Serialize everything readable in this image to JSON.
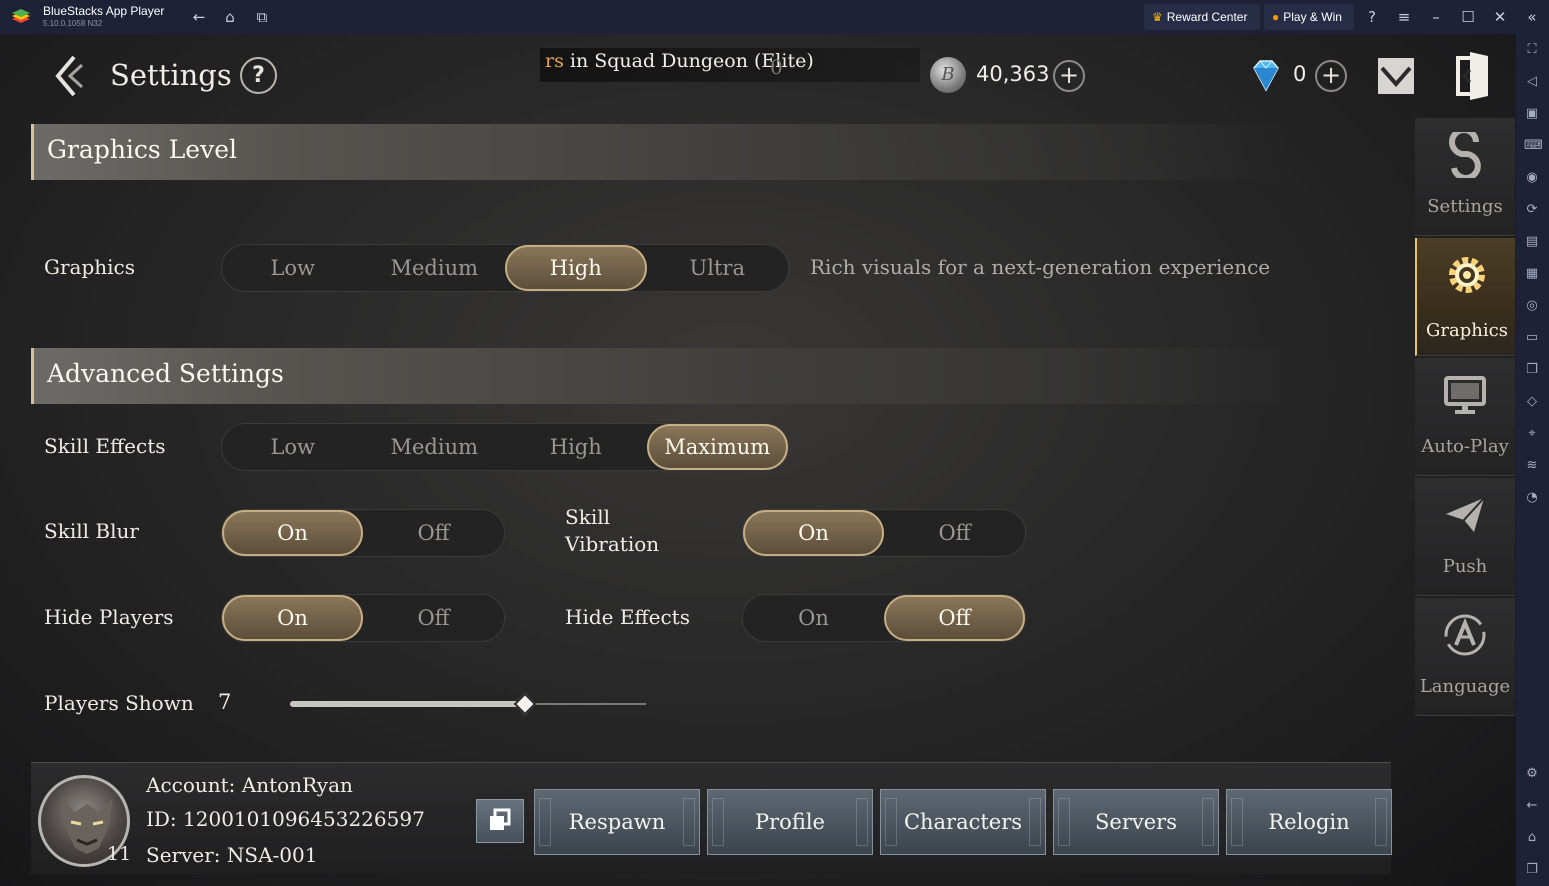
{
  "titlebar": {
    "app_name": "BlueStacks App Player",
    "version": "5.10.0.1058  N32",
    "reward_center": "Reward Center",
    "play_win": "Play & Win"
  },
  "header": {
    "title": "Settings",
    "help": "?",
    "ticker_prefix": "rs",
    "ticker_text": " in Squad Dungeon (Elite)",
    "ticker_count": "0",
    "silver_symbol": "B",
    "silver": "40,363",
    "gems": "0",
    "plus": "+"
  },
  "graphics_level": {
    "title": "Graphics Level",
    "graphics_label": "Graphics",
    "options": [
      "Low",
      "Medium",
      "High",
      "Ultra"
    ],
    "selected": "High",
    "description": "Rich visuals for a next-generation experience"
  },
  "advanced": {
    "title": "Advanced Settings",
    "skill_effects_label": "Skill Effects",
    "skill_effects_options": [
      "Low",
      "Medium",
      "High",
      "Maximum"
    ],
    "skill_effects_selected": "Maximum",
    "skill_blur_label": "Skill Blur",
    "skill_blur_selected": "On",
    "skill_vibration_label_1": "Skill",
    "skill_vibration_label_2": "Vibration",
    "skill_vibration_selected": "On",
    "hide_players_label": "Hide Players",
    "hide_players_selected": "On",
    "hide_effects_label": "Hide Effects",
    "hide_effects_selected": "Off",
    "on": "On",
    "off": "Off",
    "players_shown_label": "Players Shown",
    "players_shown_value": "7",
    "players_shown_fraction": 0.66
  },
  "side_tabs": [
    {
      "label": "Settings",
      "icon": "settings-s-icon"
    },
    {
      "label": "Graphics",
      "icon": "gear-icon"
    },
    {
      "label": "Auto-Play",
      "icon": "monitor-icon"
    },
    {
      "label": "Push",
      "icon": "paper-plane-icon"
    },
    {
      "label": "Language",
      "icon": "language-icon"
    }
  ],
  "active_tab": "Graphics",
  "account": {
    "name": "Account: AntonRyan",
    "id": "ID: 1200101096453226597",
    "server": "Server: NSA-001",
    "level": "11",
    "buttons": [
      "Respawn",
      "Profile",
      "Characters",
      "Servers",
      "Relogin"
    ]
  },
  "colors": {
    "accent_gold": "#c6ae82",
    "bluestacks_bar": "#1d2237",
    "ticker_highlight": "#e9a346"
  }
}
